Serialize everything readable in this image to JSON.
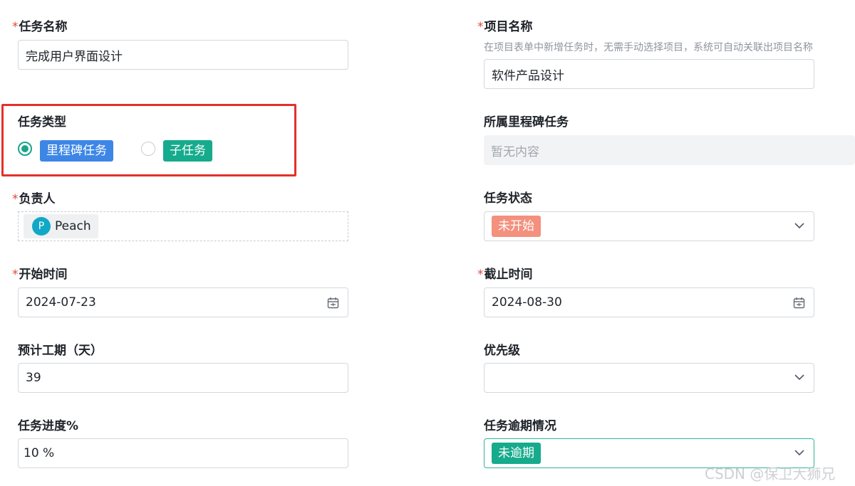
{
  "left": {
    "task_name": {
      "label": "任务名称",
      "required": "*",
      "value": "完成用户界面设计"
    },
    "task_type": {
      "label": "任务类型",
      "options": [
        {
          "label": "里程碑任务",
          "selected": true,
          "color": "#3d86e6"
        },
        {
          "label": "子任务",
          "selected": false,
          "color": "#16ab8c"
        }
      ]
    },
    "owner": {
      "label": "负责人",
      "required": "*",
      "user_initial": "P",
      "user_name": "Peach"
    },
    "start_time": {
      "label": "开始时间",
      "required": "*",
      "value": "2024-07-23"
    },
    "duration": {
      "label": "预计工期（天）",
      "value": "39"
    },
    "progress": {
      "label": "任务进度%",
      "value": "10 %"
    }
  },
  "right": {
    "project_name": {
      "label": "项目名称",
      "required": "*",
      "hint": "在项目表单中新增任务时，无需手动选择项目，系统可自动关联出项目名称",
      "value": "软件产品设计"
    },
    "milestone": {
      "label": "所属里程碑任务",
      "placeholder": "暂无内容"
    },
    "status": {
      "label": "任务状态",
      "value": "未开始",
      "color": "#f3907e"
    },
    "deadline": {
      "label": "截止时间",
      "required": "*",
      "value": "2024-08-30"
    },
    "priority": {
      "label": "优先级",
      "value": ""
    },
    "overdue": {
      "label": "任务逾期情况",
      "value": "未逾期",
      "color": "#16ab8c"
    }
  },
  "watermark": "CSDN @保卫大狮兄"
}
